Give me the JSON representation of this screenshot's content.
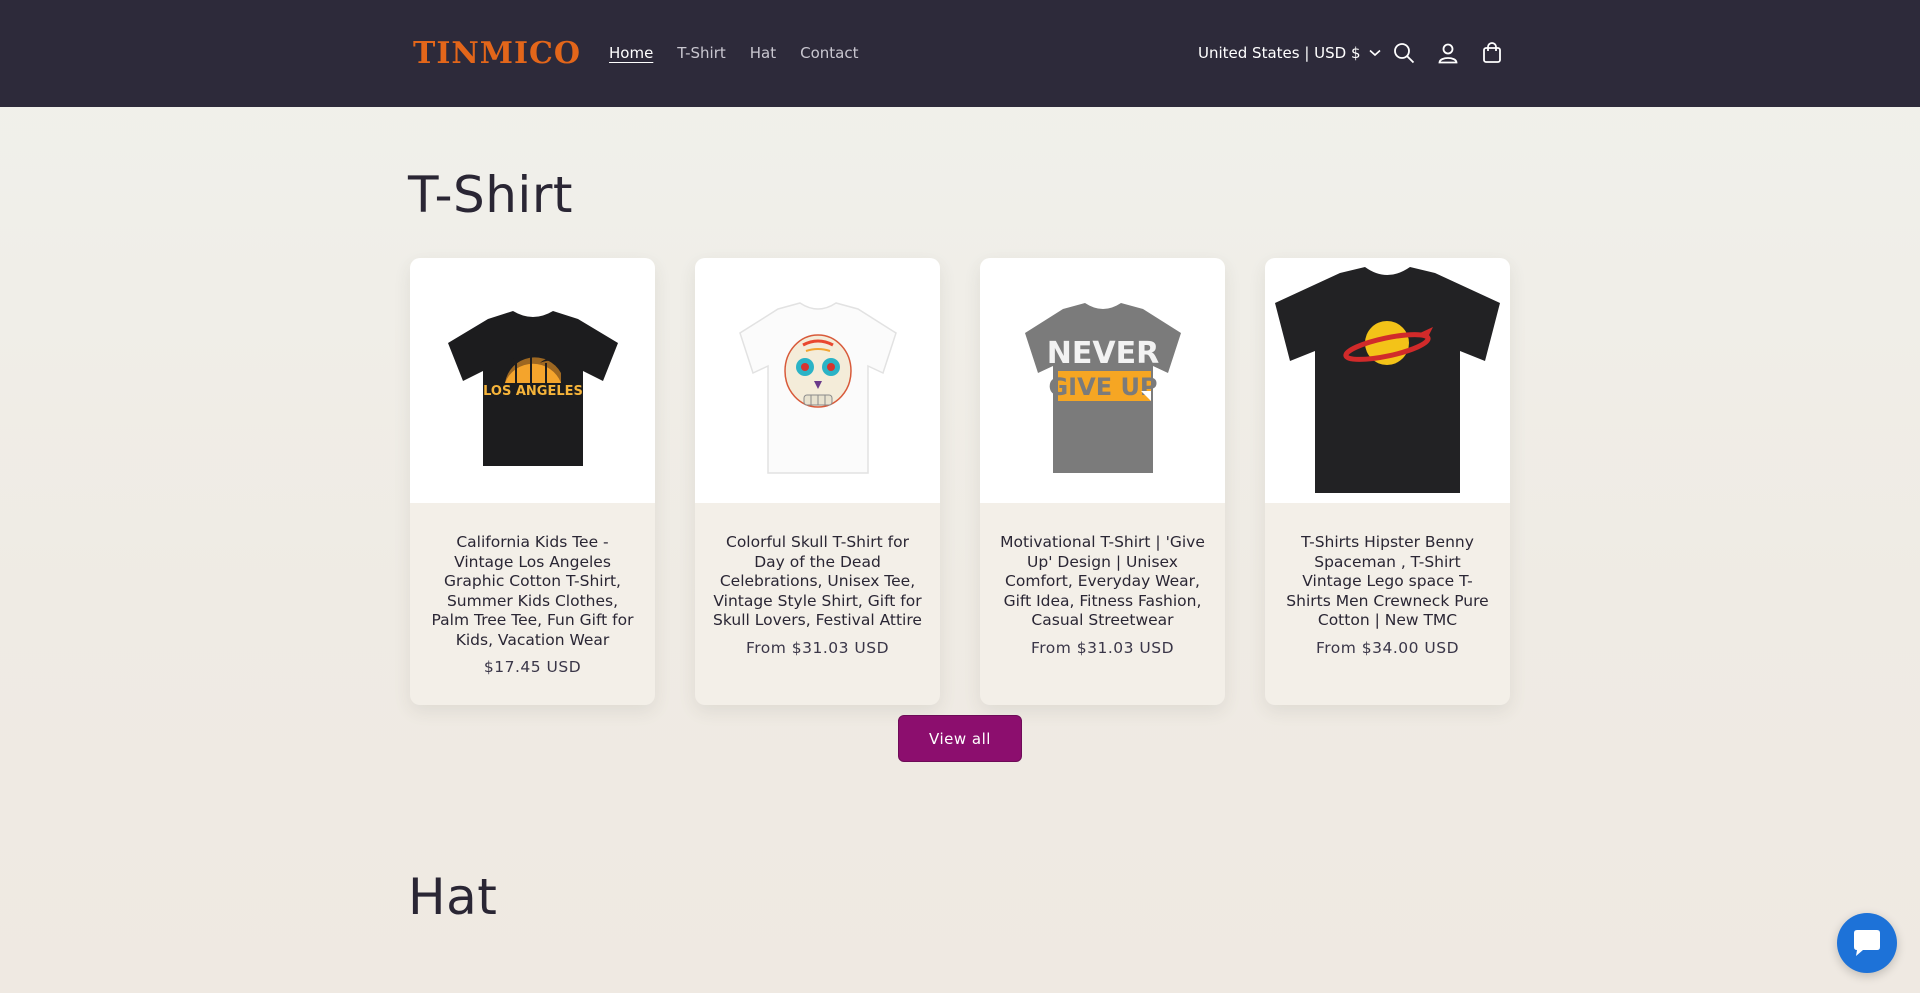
{
  "header": {
    "logo": "TINMICO",
    "nav": [
      {
        "label": "Home"
      },
      {
        "label": "T-Shirt"
      },
      {
        "label": "Hat"
      },
      {
        "label": "Contact"
      }
    ],
    "currency": "United States | USD $",
    "icons": [
      "search-icon",
      "account-icon",
      "cart-icon"
    ]
  },
  "sections": [
    {
      "title": "T-Shirt",
      "products": [
        {
          "title": "California Kids Tee - Vintage Los Angeles Graphic Cotton T-Shirt, Summer Kids Clothes, Palm Tree Tee, Fun Gift for Kids, Vacation Wear",
          "price": "$17.45 USD"
        },
        {
          "title": "Colorful Skull T-Shirt for Day of the Dead Celebrations, Unisex Tee, Vintage Style Shirt, Gift for Skull Lovers, Festival Attire",
          "price": "From $31.03 USD"
        },
        {
          "title": "Motivational T-Shirt | 'Give Up' Design | Unisex Comfort, Everyday Wear, Gift Idea, Fitness Fashion, Casual Streetwear",
          "price": "From $31.03 USD"
        },
        {
          "title": "T-Shirts Hipster Benny Spaceman , T-Shirt Vintage Lego space T-Shirts Men Crewneck Pure Cotton | New TMC",
          "price": "From $34.00 USD"
        }
      ],
      "view_all": "View all"
    },
    {
      "title": "Hat"
    }
  ],
  "graphics": {
    "la_text": "LOS ANGELES",
    "never_text": "NEVER",
    "giveup_text": "GIVE UP"
  },
  "colors": {
    "header_bg": "#2d2a3a",
    "logo": "#e3661a",
    "button": "#8c0e6e",
    "chat": "#1d72d8"
  }
}
